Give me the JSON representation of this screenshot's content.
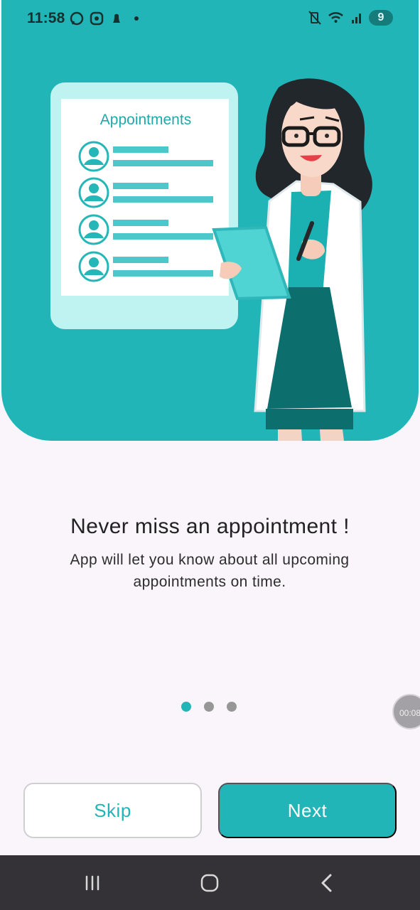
{
  "status_bar": {
    "time": "11:58",
    "battery": "9",
    "left_icons": [
      "whatsapp-icon",
      "messenger-icon",
      "snapchat-icon",
      "notification-dot-icon"
    ],
    "right_icons": [
      "vibrate-muted-icon",
      "wifi-icon",
      "signal-icon",
      "battery-charging-icon"
    ]
  },
  "hero": {
    "clipboard_title": "Appointments",
    "background_color": "#22b5b8",
    "rows": [
      {
        "icon": "person-avatar-icon"
      },
      {
        "icon": "person-avatar-icon"
      },
      {
        "icon": "person-avatar-icon"
      },
      {
        "icon": "person-avatar-icon"
      }
    ],
    "illustration": "doctor-with-clipboard-illustration"
  },
  "onboarding": {
    "title": "Never miss an appointment !",
    "subtitle_line1": "App will let you know about all upcoming",
    "subtitle_line2": "appointments on time.",
    "page_index": 1,
    "page_count": 3,
    "accent_color": "#22b5b8"
  },
  "recording_badge": {
    "text": "00:08"
  },
  "actions": {
    "skip_label": "Skip",
    "next_label": "Next"
  },
  "navigation_bar": {
    "recent_apps": "recent-apps-icon",
    "home": "home-icon",
    "back": "back-icon"
  }
}
